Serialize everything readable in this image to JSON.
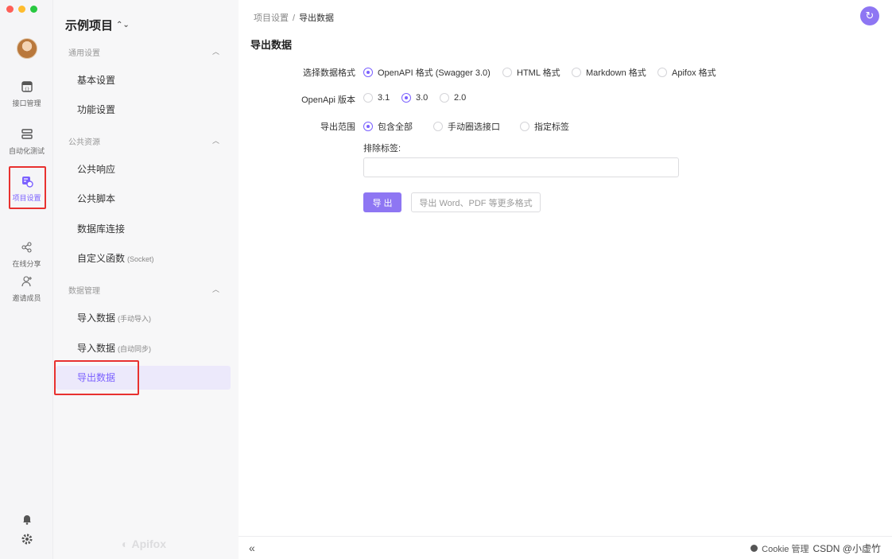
{
  "window": {
    "traffic_colors": [
      "#fe5f57",
      "#febc2e",
      "#28c840"
    ]
  },
  "rail": {
    "items": [
      {
        "label": "接口管理",
        "icon": "api-icon"
      },
      {
        "label": "自动化测试",
        "icon": "test-icon"
      },
      {
        "label": "项目设置",
        "icon": "project-settings-icon",
        "active": true
      },
      {
        "label": "在线分享",
        "icon": "share-icon"
      },
      {
        "label": "邀请成员",
        "icon": "invite-icon"
      }
    ],
    "bottom_icons": [
      "bell-icon",
      "gear-icon"
    ]
  },
  "sidebar": {
    "project_title": "示例项目",
    "project_caret": "⌃",
    "sections": [
      {
        "title": "通用设置",
        "items": [
          {
            "label": "基本设置"
          },
          {
            "label": "功能设置"
          }
        ]
      },
      {
        "title": "公共资源",
        "items": [
          {
            "label": "公共响应"
          },
          {
            "label": "公共脚本"
          },
          {
            "label": "数据库连接"
          },
          {
            "label": "自定义函数",
            "sub": "(Socket)"
          }
        ]
      },
      {
        "title": "数据管理",
        "items": [
          {
            "label": "导入数据",
            "sub": "(手动导入)"
          },
          {
            "label": "导入数据",
            "sub": "(自动同步)"
          },
          {
            "label": "导出数据",
            "active": true
          }
        ]
      }
    ],
    "watermark": "Apifox"
  },
  "main": {
    "breadcrumb": {
      "parent": "项目设置",
      "separator": "/",
      "current": "导出数据"
    },
    "page_title": "导出数据",
    "form": {
      "format_label": "选择数据格式",
      "format_options": [
        "OpenAPI 格式 (Swagger 3.0)",
        "HTML 格式",
        "Markdown 格式",
        "Apifox 格式"
      ],
      "format_selected": 0,
      "version_label": "OpenApi 版本",
      "version_options": [
        "3.1",
        "3.0",
        "2.0"
      ],
      "version_selected": 1,
      "scope_label": "导出范围",
      "scope_options": [
        "包含全部",
        "手动圈选接口",
        "指定标签"
      ],
      "scope_selected": 0,
      "exclude_label": "排除标签:",
      "exclude_value": "",
      "export_button": "导 出",
      "more_button": "导出 Word、PDF 等更多格式"
    },
    "footer": {
      "collapse": "«",
      "status": "Cookie 管理",
      "watermark": "CSDN @小虚竹"
    },
    "accent": "#7b61ff"
  }
}
